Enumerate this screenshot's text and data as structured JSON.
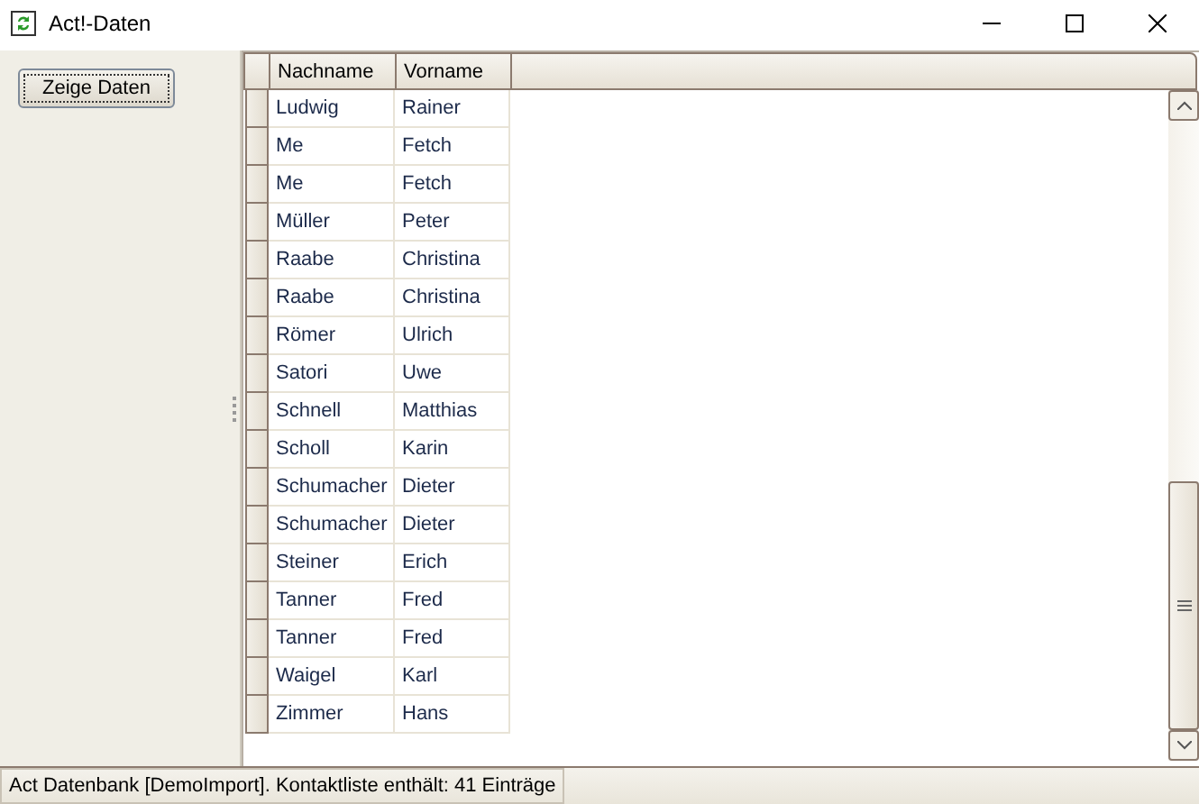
{
  "window": {
    "title": "Act!-Daten"
  },
  "left_panel": {
    "button": "Zeige Daten"
  },
  "table": {
    "columns": [
      "Nachname",
      "Vorname"
    ],
    "rows": [
      [
        "Ludwig",
        "Rainer"
      ],
      [
        "Me",
        "Fetch"
      ],
      [
        "Me",
        "Fetch"
      ],
      [
        "Müller",
        "Peter"
      ],
      [
        "Raabe",
        "Christina"
      ],
      [
        "Raabe",
        "Christina"
      ],
      [
        "Römer",
        "Ulrich"
      ],
      [
        "Satori",
        "Uwe"
      ],
      [
        "Schnell",
        "Matthias"
      ],
      [
        "Scholl",
        "Karin"
      ],
      [
        "Schumacher",
        "Dieter"
      ],
      [
        "Schumacher",
        "Dieter"
      ],
      [
        "Steiner",
        "Erich"
      ],
      [
        "Tanner",
        "Fred"
      ],
      [
        "Tanner",
        "Fred"
      ],
      [
        "Waigel",
        "Karl"
      ],
      [
        "Zimmer",
        "Hans"
      ]
    ]
  },
  "status_bar": "Act Datenbank [DemoImport]. Kontaktliste enthält: 41 Einträge"
}
